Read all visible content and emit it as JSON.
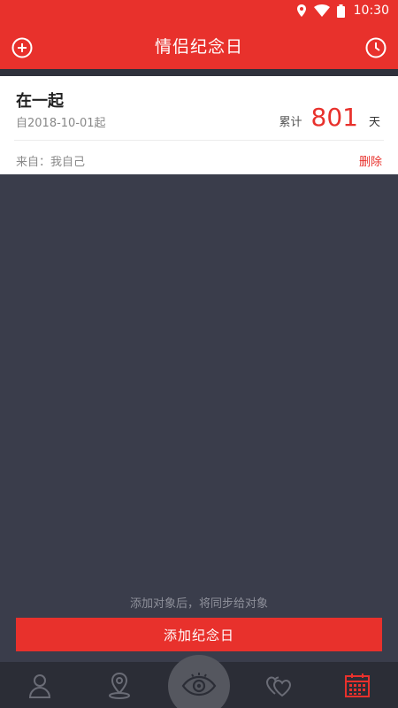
{
  "status_bar": {
    "time": "10:30",
    "icons": [
      "location-icon",
      "wifi-icon",
      "battery-icon"
    ]
  },
  "app_bar": {
    "title": "情侣纪念日",
    "left_icon": "add-circle-icon",
    "right_icon": "clock-icon"
  },
  "anniversary": {
    "name": "在一起",
    "since": "自2018-10-01起",
    "total_label": "累计",
    "days": "801",
    "unit": "天",
    "from": "来自：我自己",
    "delete_label": "删除"
  },
  "footer": {
    "hint": "添加对象后，将同步给对象",
    "add_button": "添加纪念日"
  },
  "bottom_nav": {
    "items": [
      "person-icon",
      "location-pin-icon",
      "eye-icon",
      "hearts-icon",
      "calendar-icon"
    ],
    "active": "calendar-icon"
  },
  "colors": {
    "primary": "#e8312c",
    "background": "#3a3d4b",
    "nav_bg": "#2b2d36",
    "nav_icon": "#6a6c76"
  }
}
